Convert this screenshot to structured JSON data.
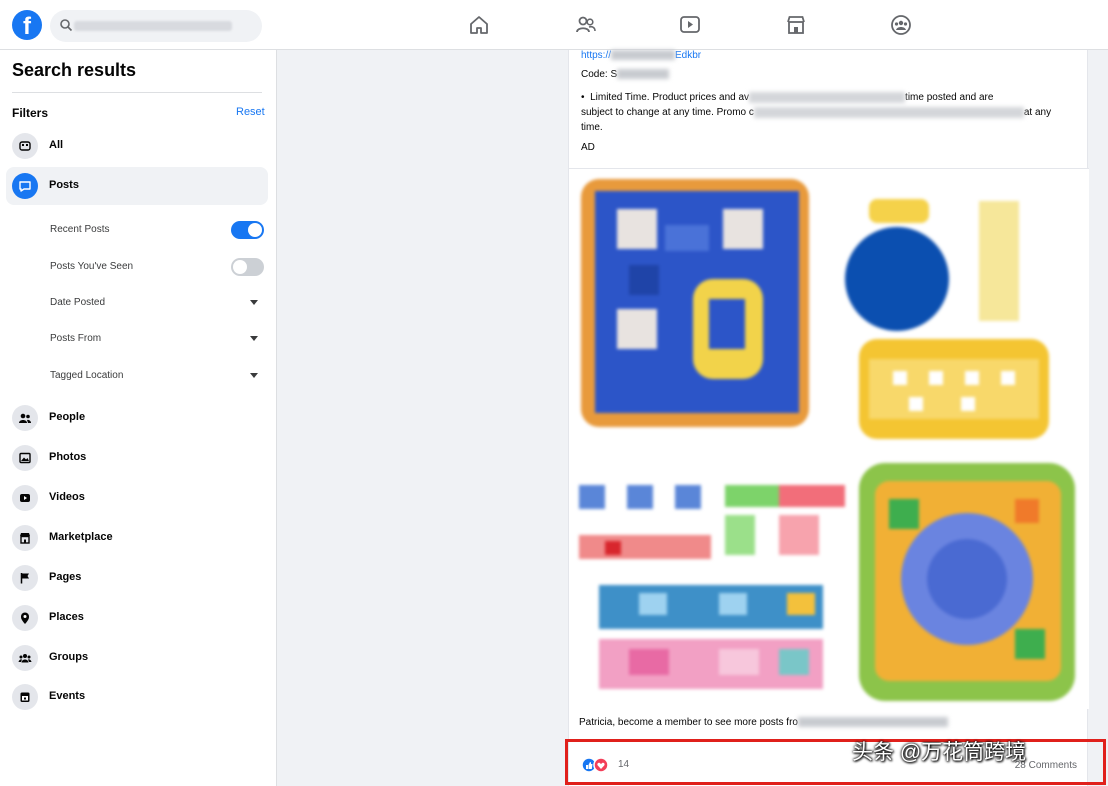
{
  "topbar": {
    "logo_letter": "f",
    "nav_icons": [
      "home-icon",
      "friends-icon",
      "watch-icon",
      "marketplace-icon",
      "groups-icon"
    ]
  },
  "sidebar": {
    "title": "Search results",
    "filters_label": "Filters",
    "reset_label": "Reset",
    "items_top": [
      {
        "label": "All",
        "icon": "all-icon"
      },
      {
        "label": "Posts",
        "icon": "posts-icon",
        "active": true
      }
    ],
    "post_filters": [
      {
        "label": "Recent Posts",
        "control": "toggle",
        "on": true
      },
      {
        "label": "Posts You've Seen",
        "control": "toggle",
        "on": false
      },
      {
        "label": "Date Posted",
        "control": "dropdown"
      },
      {
        "label": "Posts From",
        "control": "dropdown"
      },
      {
        "label": "Tagged Location",
        "control": "dropdown"
      }
    ],
    "items_bottom": [
      {
        "label": "People",
        "icon": "people-icon"
      },
      {
        "label": "Photos",
        "icon": "photos-icon"
      },
      {
        "label": "Videos",
        "icon": "videos-icon"
      },
      {
        "label": "Marketplace",
        "icon": "marketplace-icon"
      },
      {
        "label": "Pages",
        "icon": "pages-icon"
      },
      {
        "label": "Places",
        "icon": "places-icon"
      },
      {
        "label": "Groups",
        "icon": "groups-icon"
      },
      {
        "label": "Events",
        "icon": "events-icon"
      }
    ]
  },
  "post": {
    "link_prefix": "https://",
    "link_suffix": "Edkbr",
    "code_prefix": "Code: S",
    "body_bullet": "•",
    "body_start": "Limited Time. Product prices and av",
    "body_mid_end": "time posted and are",
    "body_line2_start": "subject to change at any time. Promo c",
    "body_line2_end": "at any",
    "body_line3": "time.",
    "ad_label": "AD",
    "member_text": "Patricia, become a member to see more posts fro",
    "reaction_count": "14",
    "comments_text": "28 Comments",
    "colors": {
      "like": "#1877f2",
      "love": "#f33e58"
    }
  },
  "watermark": "头条 @万花筒跨境"
}
